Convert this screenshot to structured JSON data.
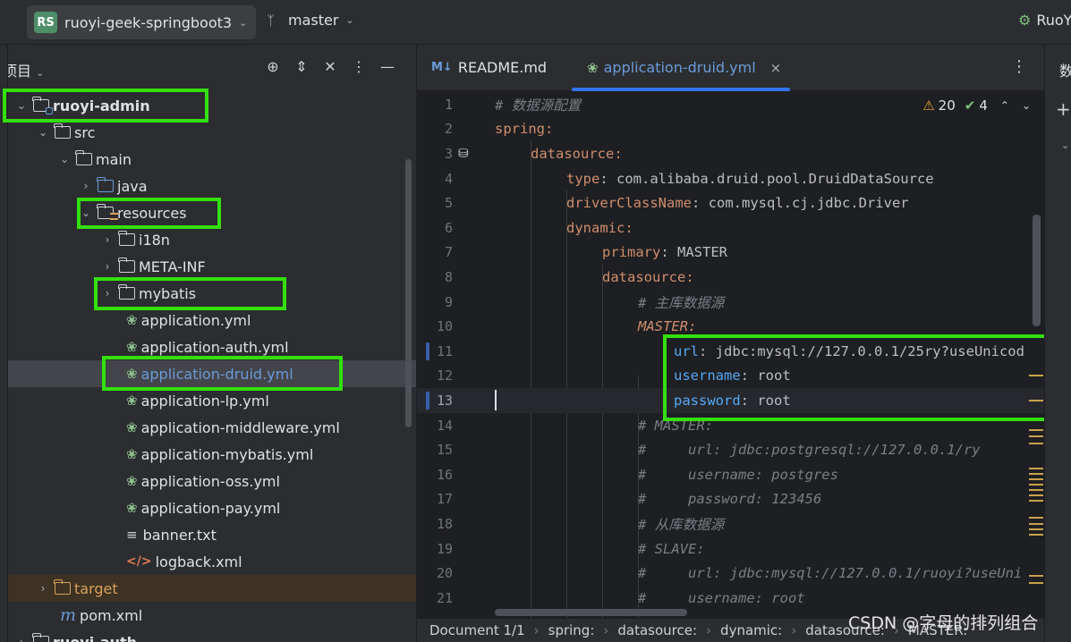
{
  "titlebar": {
    "project_badge": "RS",
    "project_name": "ruoyi-geek-springboot3",
    "branch": "master",
    "run_config": "RuoY"
  },
  "project_panel": {
    "title": "项目",
    "tree": [
      {
        "label": "ruoyi-admin",
        "icon": "module-folder-icon",
        "expanded": true
      },
      {
        "label": "src",
        "icon": "folder-icon",
        "expanded": true
      },
      {
        "label": "main",
        "icon": "folder-icon",
        "expanded": true
      },
      {
        "label": "java",
        "icon": "source-folder-icon",
        "expanded": false
      },
      {
        "label": "resources",
        "icon": "resources-folder-icon",
        "expanded": true
      },
      {
        "label": "i18n",
        "icon": "folder-icon",
        "expanded": false
      },
      {
        "label": "META-INF",
        "icon": "folder-icon",
        "expanded": false
      },
      {
        "label": "mybatis",
        "icon": "folder-icon",
        "expanded": false
      },
      {
        "label": "application.yml",
        "icon": "yaml-icon"
      },
      {
        "label": "application-auth.yml",
        "icon": "yaml-icon"
      },
      {
        "label": "application-druid.yml",
        "icon": "yaml-icon",
        "selected": true
      },
      {
        "label": "application-lp.yml",
        "icon": "yaml-icon"
      },
      {
        "label": "application-middleware.yml",
        "icon": "yaml-icon"
      },
      {
        "label": "application-mybatis.yml",
        "icon": "yaml-icon"
      },
      {
        "label": "application-oss.yml",
        "icon": "yaml-icon"
      },
      {
        "label": "application-pay.yml",
        "icon": "yaml-icon"
      },
      {
        "label": "banner.txt",
        "icon": "text-file-icon"
      },
      {
        "label": "logback.xml",
        "icon": "xml-icon"
      },
      {
        "label": "target",
        "icon": "excluded-folder-icon",
        "expanded": false
      },
      {
        "label": "pom.xml",
        "icon": "maven-icon"
      },
      {
        "label": "ruoyi-auth",
        "icon": "module-folder-icon",
        "expanded": false
      }
    ]
  },
  "editor": {
    "tabs": [
      {
        "label": "README.md",
        "icon_text": "M↓",
        "active": false
      },
      {
        "label": "application-druid.yml",
        "active": true
      }
    ],
    "inspections": {
      "warnings": "20",
      "ok": "4"
    },
    "lines": [
      {
        "n": "1",
        "text": "# 数据源配置"
      },
      {
        "n": "2",
        "text": "spring:"
      },
      {
        "n": "3",
        "text": "datasource:"
      },
      {
        "n": "4",
        "key": "type",
        "value": " com.alibaba.druid.pool.DruidDataSource"
      },
      {
        "n": "5",
        "key": "driverClassName",
        "value": " com.mysql.cj.jdbc.Driver"
      },
      {
        "n": "6",
        "text": "dynamic:"
      },
      {
        "n": "7",
        "key": "primary",
        "value": " MASTER"
      },
      {
        "n": "8",
        "text": "datasource:"
      },
      {
        "n": "9",
        "text": "# 主库数据源"
      },
      {
        "n": "10",
        "text": "MASTER:"
      },
      {
        "n": "11",
        "key": "url",
        "value": " jdbc:mysql://127.0.0.1/25ry?useUnicod"
      },
      {
        "n": "12",
        "key": "username",
        "value": " root"
      },
      {
        "n": "13",
        "key": "password",
        "value": " root"
      },
      {
        "n": "14",
        "text": "# MASTER:"
      },
      {
        "n": "15",
        "text": "#     url: jdbc:postgresql://127.0.0.1/ry"
      },
      {
        "n": "16",
        "text": "#     username: postgres"
      },
      {
        "n": "17",
        "text": "#     password: 123456"
      },
      {
        "n": "18",
        "text": "# 从库数据源"
      },
      {
        "n": "19",
        "text": "# SLAVE:"
      },
      {
        "n": "20",
        "text": "#     url: jdbc:mysql://127.0.0.1/ruoyi?useUni"
      },
      {
        "n": "21",
        "text": "#     username: root"
      }
    ],
    "breadcrumbs": [
      "Document 1/1",
      "spring:",
      "datasource:",
      "dynamic:",
      "datasource:",
      "MASTER:"
    ]
  },
  "right_panel": {
    "title": "数"
  },
  "watermark": "CSDN @字母的排列组合",
  "colors": {
    "highlight_box": "#33e00b",
    "accent": "#3574f0"
  }
}
